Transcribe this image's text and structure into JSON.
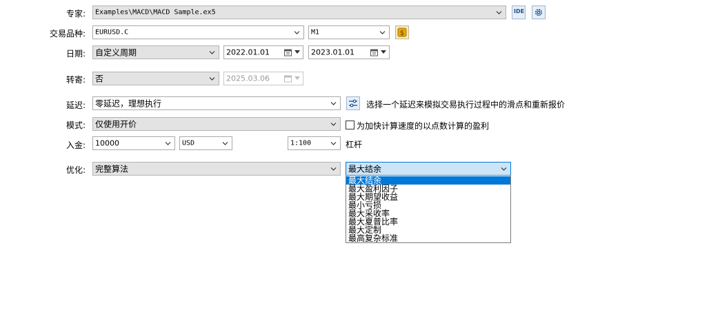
{
  "labels": {
    "expert": "专家:",
    "symbol": "交易品种:",
    "date": "日期:",
    "forward": "转寄:",
    "delay": "延迟:",
    "model": "模式:",
    "deposit": "入金:",
    "optimization": "优化:"
  },
  "expert": {
    "value": "Examples\\MACD\\MACD Sample.ex5",
    "ide_label": "IDE"
  },
  "symbol": {
    "value": "EURUSD.C",
    "timeframe": "M1"
  },
  "date": {
    "period": "自定义周期",
    "from": "2022.01.01",
    "to": "2023.01.01"
  },
  "forward": {
    "value": "否",
    "date": "2025.03.06"
  },
  "delay": {
    "value": "零延迟，理想执行",
    "hint": "选择一个延迟来模拟交易执行过程中的滑点和重新报价"
  },
  "model": {
    "value": "仅使用开价",
    "checkbox_label": "为加快计算速度的以点数计算的盈利",
    "checked": false
  },
  "deposit": {
    "amount": "10000",
    "currency": "USD",
    "leverage": "1:100",
    "leverage_label": "杠杆"
  },
  "optimization": {
    "algorithm": "完整算法",
    "criterion": "最大结余",
    "options": [
      "最大结余",
      "最大盈利因子",
      "最大期望收益",
      "最小亏损",
      "最大采收率",
      "最大夏普比率",
      "最大定制",
      "最高复杂标准"
    ],
    "selected_index": 0
  },
  "colors": {
    "accent": "#0078d7",
    "coin": "#e8a800"
  }
}
